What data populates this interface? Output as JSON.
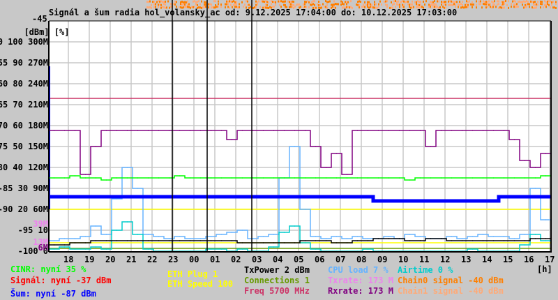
{
  "chart_data": {
    "type": "line",
    "title": "Signál a šum radia hol_volansky_ac od: 9.12.2025 17:04:00 do: 10.12.2025 17:03:00",
    "xlabel": "[h]",
    "ylabel": "[dBm] [%]",
    "x_start": "9.12.2025 17:04",
    "x_end": "10.12.2025 17:03",
    "x_ticks": [
      "18",
      "19",
      "20",
      "21",
      "22",
      "23",
      "00",
      "01",
      "02",
      "03",
      "04",
      "05",
      "06",
      "07",
      "08",
      "09",
      "10",
      "11",
      "12",
      "13",
      "14",
      "15",
      "16",
      "17"
    ],
    "y_axis_dbm": [
      -45,
      -50,
      -55,
      -60,
      -65,
      -70,
      -75,
      -80,
      -85,
      -90,
      -95,
      -100
    ],
    "y_axis_pct": [
      100,
      90,
      80,
      70,
      60,
      50,
      40,
      30,
      20,
      10,
      0
    ],
    "y_axis_rate": [
      "300M",
      "270M",
      "240M",
      "210M",
      "180M",
      "150M",
      "120M",
      "90M",
      "60M"
    ],
    "y_ticks_text": [
      "-50 100 300M",
      "-55 90 270M",
      "-60 80 240M",
      "-65 70 210M",
      "-70 60 180M",
      "-75 50 150M",
      "-80 40 120M",
      "-85 30 90M",
      "-90 20 60M",
      "-95 10",
      "-100 0"
    ],
    "extra_rate_labels": [
      {
        "text": "39M",
        "color": "#ee82ee"
      },
      {
        "text": "13M",
        "color": "#ee82ee"
      },
      {
        "text": "6M",
        "color": "#800080"
      }
    ],
    "ylim_dbm": [
      -100,
      -45
    ],
    "grid": true,
    "sample_interval": "30 min",
    "series": [
      {
        "name": "CPU load",
        "color": "#66b3ff",
        "unit": "%",
        "values": [
          5,
          6,
          6,
          7,
          12,
          8,
          25,
          40,
          30,
          8,
          7,
          6,
          7,
          6,
          6,
          7,
          8,
          9,
          10,
          6,
          7,
          8,
          35,
          50,
          20,
          7,
          6,
          7,
          6,
          7,
          6,
          6,
          7,
          6,
          8,
          7,
          6,
          6,
          7,
          6,
          7,
          8,
          7,
          7,
          6,
          8,
          30,
          15
        ]
      },
      {
        "name": "Airtime",
        "color": "#00cccc",
        "unit": "%",
        "values": [
          1,
          2,
          1,
          1,
          2,
          1,
          10,
          14,
          8,
          1,
          0,
          0,
          0,
          0,
          0,
          1,
          1,
          0,
          1,
          0,
          0,
          2,
          9,
          12,
          4,
          1,
          0,
          0,
          0,
          0,
          1,
          0,
          0,
          0,
          0,
          0,
          0,
          0,
          0,
          0,
          1,
          0,
          0,
          0,
          0,
          3,
          8,
          5
        ]
      },
      {
        "name": "Rxrate",
        "color": "#800080",
        "unit": "M",
        "values": [
          173,
          173,
          173,
          110,
          150,
          173,
          173,
          173,
          173,
          173,
          173,
          173,
          173,
          173,
          173,
          173,
          173,
          160,
          173,
          173,
          173,
          173,
          173,
          173,
          173,
          150,
          120,
          140,
          110,
          173,
          173,
          173,
          173,
          173,
          173,
          173,
          150,
          173,
          173,
          173,
          173,
          173,
          173,
          173,
          160,
          130,
          120,
          140
        ]
      },
      {
        "name": "CINR",
        "color": "#00ff00",
        "unit": "%",
        "values": [
          35,
          35,
          36,
          35,
          35,
          34,
          35,
          35,
          35,
          35,
          35,
          35,
          36,
          35,
          35,
          35,
          35,
          35,
          35,
          35,
          35,
          35,
          35,
          35,
          35,
          35,
          35,
          35,
          35,
          35,
          35,
          35,
          35,
          35,
          34,
          35,
          35,
          35,
          35,
          35,
          35,
          35,
          35,
          35,
          35,
          35,
          35,
          36
        ]
      },
      {
        "name": "Šum",
        "color": "#0000ff",
        "unit": "dBm",
        "values": [
          -87,
          -87,
          -87,
          -87,
          -87,
          -87,
          -87,
          -87,
          -87,
          -87,
          -87,
          -87,
          -87,
          -87,
          -87,
          -87,
          -87,
          -87,
          -87,
          -87,
          -87,
          -87,
          -87,
          -87,
          -87,
          -87,
          -87,
          -87,
          -87,
          -87,
          -87,
          -88,
          -88,
          -88,
          -88,
          -88,
          -88,
          -88,
          -88,
          -88,
          -88,
          -88,
          -88,
          -87,
          -87,
          -87,
          -87,
          -87
        ]
      },
      {
        "name": "TxPower",
        "color": "#000000",
        "unit": "%",
        "values": [
          3,
          3,
          4,
          4,
          5,
          5,
          5,
          5,
          5,
          5,
          5,
          5,
          5,
          5,
          5,
          5,
          5,
          5,
          4,
          4,
          4,
          4,
          4,
          4,
          5,
          5,
          5,
          4,
          4,
          5,
          5,
          6,
          6,
          6,
          5,
          5,
          6,
          6,
          5,
          5,
          5,
          5,
          5,
          5,
          5,
          5,
          6,
          6
        ]
      }
    ],
    "markers": [
      "22:58",
      "00:38",
      "02:46"
    ]
  },
  "legend": {
    "cinr": {
      "text": "CINR: nyní 35 %",
      "color": "#00ff00"
    },
    "signal": {
      "text": "Signál: nyní -37 dBm",
      "color": "#ff0000"
    },
    "noise": {
      "text": "Šum: nyní -87 dBm",
      "color": "#0000ff"
    },
    "eth_plug": {
      "text": "ETH Plug 1",
      "color": "#ffff00"
    },
    "eth_speed": {
      "text": "ETH Speed 100",
      "color": "#ffff00"
    },
    "txpower": {
      "text": "TxPower 2 dBm",
      "color": "#000000"
    },
    "connections": {
      "text": "Connections 1",
      "color": "#669900"
    },
    "freq": {
      "text": "Freq 5700 MHz",
      "color": "#cc3366"
    },
    "cpu": {
      "text": "CPU load 7 %",
      "color": "#66b3ff"
    },
    "txrate": {
      "text": "Txrate: 173 M",
      "color": "#ee82ee"
    },
    "rxrate": {
      "text": "Rxrate: 173 M",
      "color": "#800080"
    },
    "airtime": {
      "text": "Airtime 0 %",
      "color": "#00cccc"
    },
    "chain0": {
      "text": "Chain0 signal -40 dBm",
      "color": "#ff7f00"
    },
    "chain1": {
      "text": "Chain1 signal -40 dBm",
      "color": "#ffaa77"
    }
  }
}
